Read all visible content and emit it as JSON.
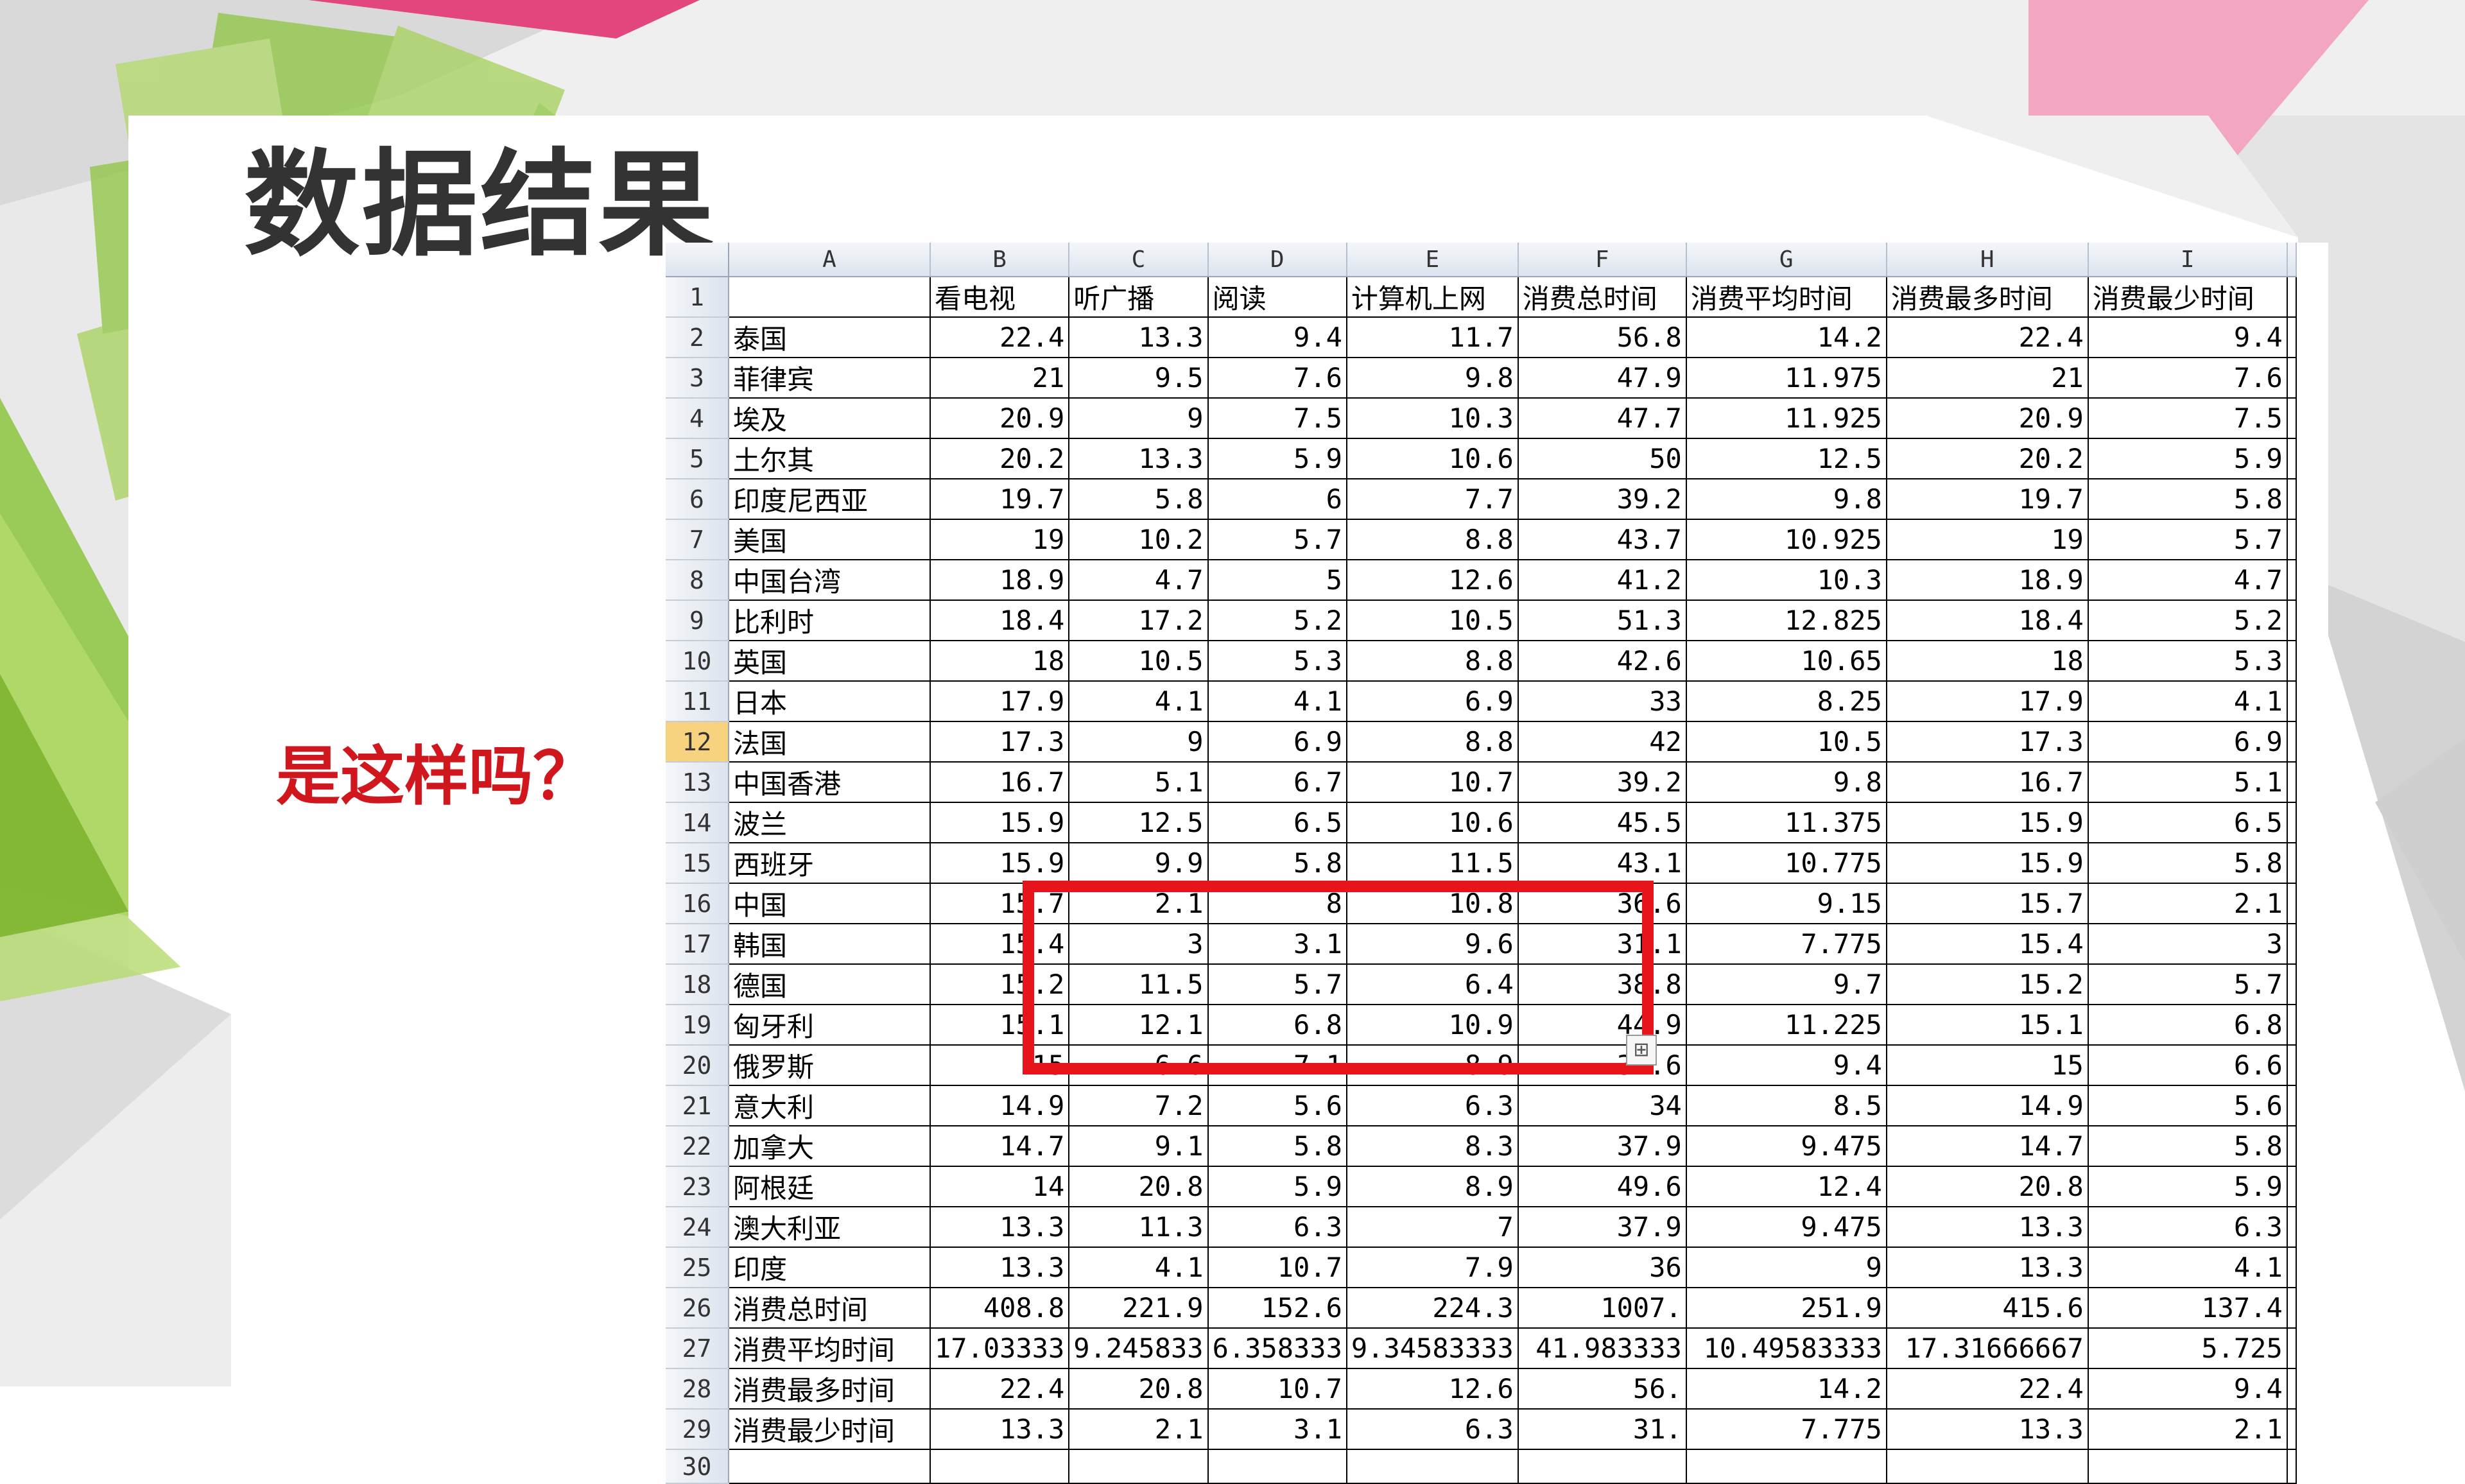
{
  "slide": {
    "title": "数据结果",
    "question": "是这样吗？",
    "accent_color": "#d0171d",
    "title_color": "#333333",
    "highlight_color": "#e8141c"
  },
  "sheet": {
    "column_letters": [
      "A",
      "B",
      "C",
      "D",
      "E",
      "F",
      "G",
      "H",
      "I"
    ],
    "rows": [
      {
        "n": "1",
        "cells": [
          "",
          "看电视",
          "听广播",
          "阅读",
          "计算机上网",
          "消费总时间",
          "消费平均时间",
          "消费最多时间",
          "消费最少时间"
        ]
      },
      {
        "n": "2",
        "cells": [
          "泰国",
          "22.4",
          "13.3",
          "9.4",
          "11.7",
          "56.8",
          "14.2",
          "22.4",
          "9.4"
        ]
      },
      {
        "n": "3",
        "cells": [
          "菲律宾",
          "21",
          "9.5",
          "7.6",
          "9.8",
          "47.9",
          "11.975",
          "21",
          "7.6"
        ]
      },
      {
        "n": "4",
        "cells": [
          "埃及",
          "20.9",
          "9",
          "7.5",
          "10.3",
          "47.7",
          "11.925",
          "20.9",
          "7.5"
        ]
      },
      {
        "n": "5",
        "cells": [
          "土尔其",
          "20.2",
          "13.3",
          "5.9",
          "10.6",
          "50",
          "12.5",
          "20.2",
          "5.9"
        ]
      },
      {
        "n": "6",
        "cells": [
          "印度尼西亚",
          "19.7",
          "5.8",
          "6",
          "7.7",
          "39.2",
          "9.8",
          "19.7",
          "5.8"
        ]
      },
      {
        "n": "7",
        "cells": [
          "美国",
          "19",
          "10.2",
          "5.7",
          "8.8",
          "43.7",
          "10.925",
          "19",
          "5.7"
        ]
      },
      {
        "n": "8",
        "cells": [
          "中国台湾",
          "18.9",
          "4.7",
          "5",
          "12.6",
          "41.2",
          "10.3",
          "18.9",
          "4.7"
        ]
      },
      {
        "n": "9",
        "cells": [
          "比利时",
          "18.4",
          "17.2",
          "5.2",
          "10.5",
          "51.3",
          "12.825",
          "18.4",
          "5.2"
        ]
      },
      {
        "n": "10",
        "cells": [
          "英国",
          "18",
          "10.5",
          "5.3",
          "8.8",
          "42.6",
          "10.65",
          "18",
          "5.3"
        ]
      },
      {
        "n": "11",
        "cells": [
          "日本",
          "17.9",
          "4.1",
          "4.1",
          "6.9",
          "33",
          "8.25",
          "17.9",
          "4.1"
        ]
      },
      {
        "n": "12",
        "cells": [
          "法国",
          "17.3",
          "9",
          "6.9",
          "8.8",
          "42",
          "10.5",
          "17.3",
          "6.9"
        ]
      },
      {
        "n": "13",
        "cells": [
          "中国香港",
          "16.7",
          "5.1",
          "6.7",
          "10.7",
          "39.2",
          "9.8",
          "16.7",
          "5.1"
        ]
      },
      {
        "n": "14",
        "cells": [
          "波兰",
          "15.9",
          "12.5",
          "6.5",
          "10.6",
          "45.5",
          "11.375",
          "15.9",
          "6.5"
        ]
      },
      {
        "n": "15",
        "cells": [
          "西班牙",
          "15.9",
          "9.9",
          "5.8",
          "11.5",
          "43.1",
          "10.775",
          "15.9",
          "5.8"
        ]
      },
      {
        "n": "16",
        "cells": [
          "中国",
          "15.7",
          "2.1",
          "8",
          "10.8",
          "36.6",
          "9.15",
          "15.7",
          "2.1"
        ]
      },
      {
        "n": "17",
        "cells": [
          "韩国",
          "15.4",
          "3",
          "3.1",
          "9.6",
          "31.1",
          "7.775",
          "15.4",
          "3"
        ]
      },
      {
        "n": "18",
        "cells": [
          "德国",
          "15.2",
          "11.5",
          "5.7",
          "6.4",
          "38.8",
          "9.7",
          "15.2",
          "5.7"
        ]
      },
      {
        "n": "19",
        "cells": [
          "匈牙利",
          "15.1",
          "12.1",
          "6.8",
          "10.9",
          "44.9",
          "11.225",
          "15.1",
          "6.8"
        ]
      },
      {
        "n": "20",
        "cells": [
          "俄罗斯",
          "15",
          "6.6",
          "7.1",
          "8.9",
          "37.6",
          "9.4",
          "15",
          "6.6"
        ]
      },
      {
        "n": "21",
        "cells": [
          "意大利",
          "14.9",
          "7.2",
          "5.6",
          "6.3",
          "34",
          "8.5",
          "14.9",
          "5.6"
        ]
      },
      {
        "n": "22",
        "cells": [
          "加拿大",
          "14.7",
          "9.1",
          "5.8",
          "8.3",
          "37.9",
          "9.475",
          "14.7",
          "5.8"
        ]
      },
      {
        "n": "23",
        "cells": [
          "阿根廷",
          "14",
          "20.8",
          "5.9",
          "8.9",
          "49.6",
          "12.4",
          "20.8",
          "5.9"
        ]
      },
      {
        "n": "24",
        "cells": [
          "澳大利亚",
          "13.3",
          "11.3",
          "6.3",
          "7",
          "37.9",
          "9.475",
          "13.3",
          "6.3"
        ]
      },
      {
        "n": "25",
        "cells": [
          "印度",
          "13.3",
          "4.1",
          "10.7",
          "7.9",
          "36",
          "9",
          "13.3",
          "4.1"
        ]
      },
      {
        "n": "26",
        "cells": [
          "消费总时间",
          "408.8",
          "221.9",
          "152.6",
          "224.3",
          "1007.",
          "251.9",
          "415.6",
          "137.4"
        ]
      },
      {
        "n": "27",
        "cells": [
          "消费平均时间",
          "17.03333",
          "9.245833",
          "6.358333",
          "9.34583333",
          "41.983333",
          "10.49583333",
          "17.31666667",
          "5.725"
        ]
      },
      {
        "n": "28",
        "cells": [
          "消费最多时间",
          "22.4",
          "20.8",
          "10.7",
          "12.6",
          "56.",
          "14.2",
          "22.4",
          "9.4"
        ]
      },
      {
        "n": "29",
        "cells": [
          "消费最少时间",
          "13.3",
          "2.1",
          "3.1",
          "6.3",
          "31.",
          "7.775",
          "13.3",
          "2.1"
        ]
      },
      {
        "n": "30",
        "cells": [
          "",
          "",
          "",
          "",
          "",
          "",
          "",
          "",
          ""
        ]
      }
    ],
    "selected_row": "12",
    "paste_icon": "paste-options-icon"
  }
}
